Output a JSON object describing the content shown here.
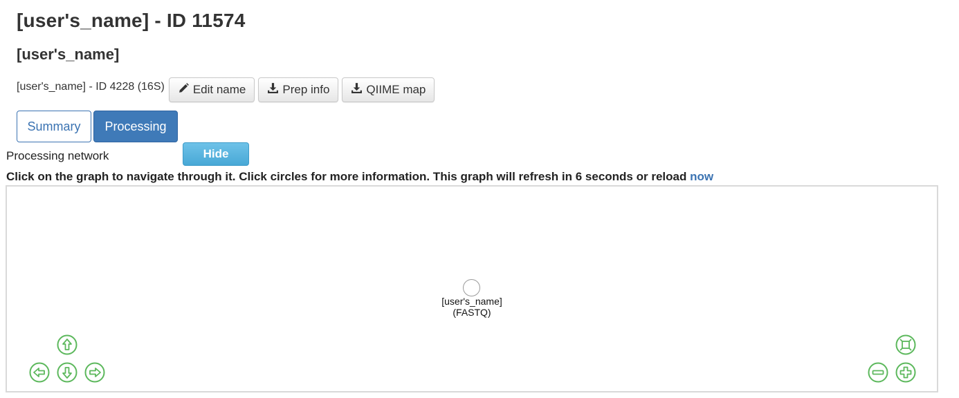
{
  "header": {
    "title": "[user's_name] - ID 11574",
    "subtitle": "[user's_name]"
  },
  "prep": {
    "label": "[user's_name] - ID 4228 (16S)",
    "edit_name_label": "Edit name",
    "prep_info_label": "Prep info",
    "qiime_map_label": "QIIME map"
  },
  "tabs": {
    "summary": "Summary",
    "processing": "Processing",
    "active": "Processing"
  },
  "network": {
    "label": "Processing network",
    "hide_label": "Hide",
    "instructions": "Click on the graph to navigate through it. Click circles for more information. This graph will refresh in 6 seconds or reload",
    "reload_link": "now",
    "node": {
      "name": "[user's_name]",
      "type": "(FASTQ)"
    }
  },
  "icons": {
    "edit": "pencil-icon",
    "download": "download-icon",
    "up": "arrow-up-icon",
    "down": "arrow-down-icon",
    "left": "arrow-left-icon",
    "right": "arrow-right-icon",
    "fit": "zoom-fit-icon",
    "zoom_out": "zoom-out-icon",
    "zoom_in": "zoom-in-icon"
  },
  "colors": {
    "primary": "#3f7ab8",
    "info": "#5bb8e0",
    "link": "#3b73b2",
    "nav_control": "#5cb85c"
  }
}
